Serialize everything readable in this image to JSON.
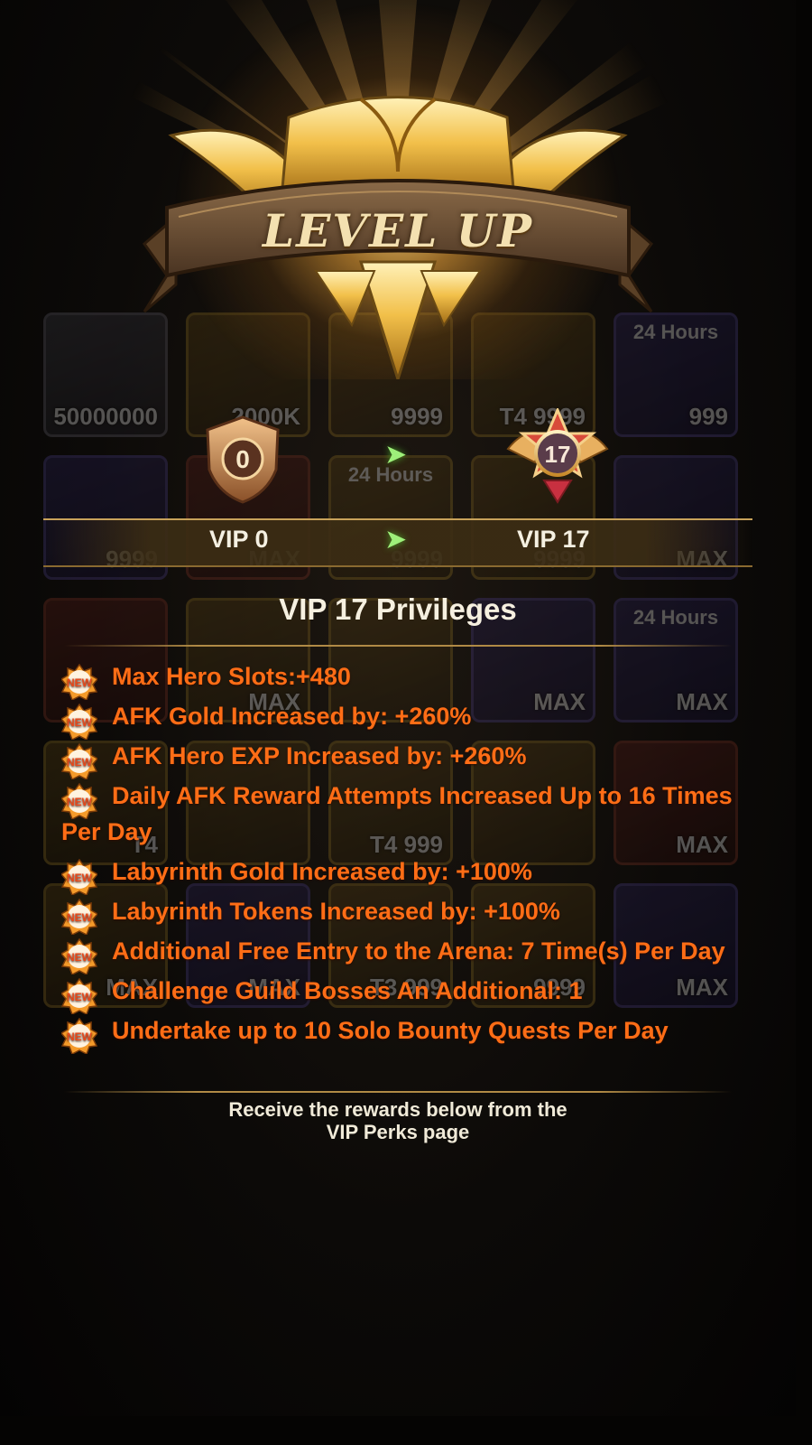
{
  "banner": {
    "title": "LEVEL UP"
  },
  "background_tiles": [
    {
      "style": "grey",
      "qty": "50000000",
      "top": ""
    },
    {
      "style": "gold",
      "qty": "2000K",
      "top": ""
    },
    {
      "style": "gold",
      "qty": "9999",
      "top": ""
    },
    {
      "style": "gold",
      "qty": "T4 9999",
      "top": ""
    },
    {
      "style": "purple",
      "qty": "999",
      "top": "24 Hours"
    },
    {
      "style": "purple",
      "qty": "9999",
      "top": ""
    },
    {
      "style": "red",
      "qty": "MAX",
      "top": ""
    },
    {
      "style": "gold",
      "qty": "9999",
      "top": "24 Hours"
    },
    {
      "style": "gold",
      "qty": "9999",
      "top": ""
    },
    {
      "style": "purple",
      "qty": "MAX",
      "top": ""
    },
    {
      "style": "red",
      "qty": "",
      "top": ""
    },
    {
      "style": "gold",
      "qty": "MAX",
      "top": ""
    },
    {
      "style": "gold",
      "qty": "",
      "top": ""
    },
    {
      "style": "purple",
      "qty": "MAX",
      "top": ""
    },
    {
      "style": "purple",
      "qty": "MAX",
      "top": "24 Hours"
    },
    {
      "style": "gold",
      "qty": "T4",
      "top": ""
    },
    {
      "style": "gold",
      "qty": "",
      "top": ""
    },
    {
      "style": "gold",
      "qty": "T4 999",
      "top": ""
    },
    {
      "style": "gold",
      "qty": "",
      "top": ""
    },
    {
      "style": "red",
      "qty": "MAX",
      "top": ""
    },
    {
      "style": "gold",
      "qty": "MAX",
      "top": ""
    },
    {
      "style": "purple",
      "qty": "MAX",
      "top": ""
    },
    {
      "style": "gold",
      "qty": "T3 999",
      "top": ""
    },
    {
      "style": "gold",
      "qty": "9999",
      "top": ""
    },
    {
      "style": "purple",
      "qty": "MAX",
      "top": ""
    }
  ],
  "vip": {
    "from_badge": "0",
    "to_badge": "17",
    "from_label": "VIP 0",
    "to_label": "VIP 17",
    "arrow_icon": "double-chevron-right-icon"
  },
  "privileges": {
    "title": "VIP 17 Privileges",
    "new_badge": "NEW",
    "items": [
      "Max Hero Slots:+480",
      "AFK Gold Increased by: +260%",
      "AFK Hero EXP Increased by: +260%",
      "Daily AFK Reward Attempts Increased Up to 16 Times Per Day",
      "Labyrinth Gold Increased by: +100%",
      "Labyrinth Tokens Increased by: +100%",
      "Additional Free Entry to the Arena: 7 Time(s) Per Day",
      "Challenge Guild Bosses An Additional: 1",
      "Undertake up to 10 Solo Bounty Quests Per Day"
    ]
  },
  "footer": {
    "line1": "Receive the rewards below from the",
    "line2": "VIP Perks page"
  },
  "colors": {
    "privilege_text": "#ff6d16",
    "gold_accent": "#c8a25a",
    "arrow_green": "#9ef07a"
  }
}
